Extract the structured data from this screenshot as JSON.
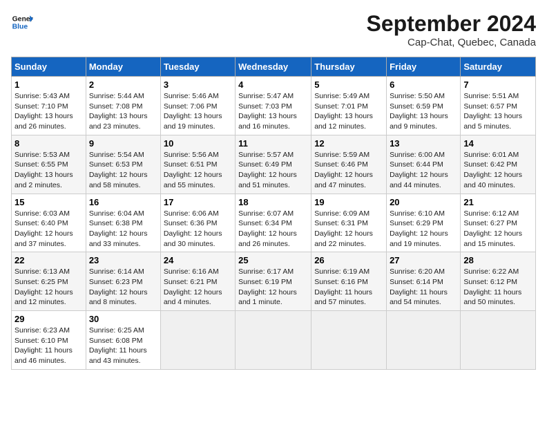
{
  "header": {
    "logo_general": "General",
    "logo_blue": "Blue",
    "month_title": "September 2024",
    "location": "Cap-Chat, Quebec, Canada"
  },
  "weekdays": [
    "Sunday",
    "Monday",
    "Tuesday",
    "Wednesday",
    "Thursday",
    "Friday",
    "Saturday"
  ],
  "weeks": [
    [
      {
        "day": "1",
        "info": "Sunrise: 5:43 AM\nSunset: 7:10 PM\nDaylight: 13 hours\nand 26 minutes."
      },
      {
        "day": "2",
        "info": "Sunrise: 5:44 AM\nSunset: 7:08 PM\nDaylight: 13 hours\nand 23 minutes."
      },
      {
        "day": "3",
        "info": "Sunrise: 5:46 AM\nSunset: 7:06 PM\nDaylight: 13 hours\nand 19 minutes."
      },
      {
        "day": "4",
        "info": "Sunrise: 5:47 AM\nSunset: 7:03 PM\nDaylight: 13 hours\nand 16 minutes."
      },
      {
        "day": "5",
        "info": "Sunrise: 5:49 AM\nSunset: 7:01 PM\nDaylight: 13 hours\nand 12 minutes."
      },
      {
        "day": "6",
        "info": "Sunrise: 5:50 AM\nSunset: 6:59 PM\nDaylight: 13 hours\nand 9 minutes."
      },
      {
        "day": "7",
        "info": "Sunrise: 5:51 AM\nSunset: 6:57 PM\nDaylight: 13 hours\nand 5 minutes."
      }
    ],
    [
      {
        "day": "8",
        "info": "Sunrise: 5:53 AM\nSunset: 6:55 PM\nDaylight: 13 hours\nand 2 minutes."
      },
      {
        "day": "9",
        "info": "Sunrise: 5:54 AM\nSunset: 6:53 PM\nDaylight: 12 hours\nand 58 minutes."
      },
      {
        "day": "10",
        "info": "Sunrise: 5:56 AM\nSunset: 6:51 PM\nDaylight: 12 hours\nand 55 minutes."
      },
      {
        "day": "11",
        "info": "Sunrise: 5:57 AM\nSunset: 6:49 PM\nDaylight: 12 hours\nand 51 minutes."
      },
      {
        "day": "12",
        "info": "Sunrise: 5:59 AM\nSunset: 6:46 PM\nDaylight: 12 hours\nand 47 minutes."
      },
      {
        "day": "13",
        "info": "Sunrise: 6:00 AM\nSunset: 6:44 PM\nDaylight: 12 hours\nand 44 minutes."
      },
      {
        "day": "14",
        "info": "Sunrise: 6:01 AM\nSunset: 6:42 PM\nDaylight: 12 hours\nand 40 minutes."
      }
    ],
    [
      {
        "day": "15",
        "info": "Sunrise: 6:03 AM\nSunset: 6:40 PM\nDaylight: 12 hours\nand 37 minutes."
      },
      {
        "day": "16",
        "info": "Sunrise: 6:04 AM\nSunset: 6:38 PM\nDaylight: 12 hours\nand 33 minutes."
      },
      {
        "day": "17",
        "info": "Sunrise: 6:06 AM\nSunset: 6:36 PM\nDaylight: 12 hours\nand 30 minutes."
      },
      {
        "day": "18",
        "info": "Sunrise: 6:07 AM\nSunset: 6:34 PM\nDaylight: 12 hours\nand 26 minutes."
      },
      {
        "day": "19",
        "info": "Sunrise: 6:09 AM\nSunset: 6:31 PM\nDaylight: 12 hours\nand 22 minutes."
      },
      {
        "day": "20",
        "info": "Sunrise: 6:10 AM\nSunset: 6:29 PM\nDaylight: 12 hours\nand 19 minutes."
      },
      {
        "day": "21",
        "info": "Sunrise: 6:12 AM\nSunset: 6:27 PM\nDaylight: 12 hours\nand 15 minutes."
      }
    ],
    [
      {
        "day": "22",
        "info": "Sunrise: 6:13 AM\nSunset: 6:25 PM\nDaylight: 12 hours\nand 12 minutes."
      },
      {
        "day": "23",
        "info": "Sunrise: 6:14 AM\nSunset: 6:23 PM\nDaylight: 12 hours\nand 8 minutes."
      },
      {
        "day": "24",
        "info": "Sunrise: 6:16 AM\nSunset: 6:21 PM\nDaylight: 12 hours\nand 4 minutes."
      },
      {
        "day": "25",
        "info": "Sunrise: 6:17 AM\nSunset: 6:19 PM\nDaylight: 12 hours\nand 1 minute."
      },
      {
        "day": "26",
        "info": "Sunrise: 6:19 AM\nSunset: 6:16 PM\nDaylight: 11 hours\nand 57 minutes."
      },
      {
        "day": "27",
        "info": "Sunrise: 6:20 AM\nSunset: 6:14 PM\nDaylight: 11 hours\nand 54 minutes."
      },
      {
        "day": "28",
        "info": "Sunrise: 6:22 AM\nSunset: 6:12 PM\nDaylight: 11 hours\nand 50 minutes."
      }
    ],
    [
      {
        "day": "29",
        "info": "Sunrise: 6:23 AM\nSunset: 6:10 PM\nDaylight: 11 hours\nand 46 minutes."
      },
      {
        "day": "30",
        "info": "Sunrise: 6:25 AM\nSunset: 6:08 PM\nDaylight: 11 hours\nand 43 minutes."
      },
      {
        "day": "",
        "info": ""
      },
      {
        "day": "",
        "info": ""
      },
      {
        "day": "",
        "info": ""
      },
      {
        "day": "",
        "info": ""
      },
      {
        "day": "",
        "info": ""
      }
    ]
  ]
}
